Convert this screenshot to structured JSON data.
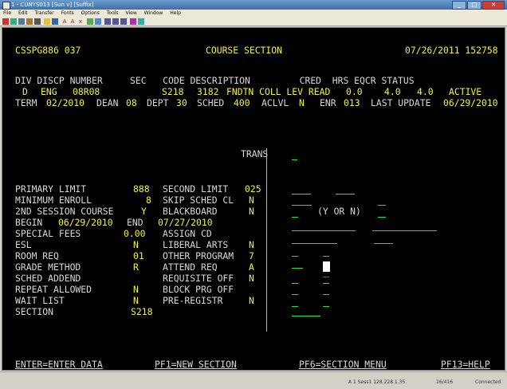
{
  "window": {
    "title": "1 - CUNYS013 [Sun v] [Suffix]",
    "minimize": "_",
    "maximize": "□",
    "close": "✕"
  },
  "menu": [
    "File",
    "Edit",
    "Transfer",
    "Fonts",
    "Options",
    "Tools",
    "View",
    "Window",
    "Help"
  ],
  "screen": {
    "header": {
      "program": "CSSPG886 037",
      "title": "COURSE SECTION",
      "datetime": "07/26/2011 152758"
    },
    "col_headers": "DIV DISCP NUMBER     SEC   CODE DESCRIPTION         CRED  HRS EQCR STATUS",
    "course": {
      "div": "D",
      "discp": "ENG",
      "number": "08R08",
      "sec": "S218",
      "code": "3182",
      "description": "FNDTN COLL LEV READ",
      "cred": "0.0",
      "hrs": "4.0",
      "eqcr": "4.0",
      "status": "ACTIVE"
    },
    "term": {
      "term_label": "TERM",
      "term": "02/2010",
      "dean_label": "DEAN",
      "dean": "08",
      "dept_label": "DEPT",
      "dept": "30",
      "sched_label": "SCHED",
      "sched": "400",
      "aclvl_label": "ACLVL",
      "aclvl": "N",
      "enr_label": "ENR",
      "enr": "013",
      "lastupd_label": "LAST UPDATE",
      "lastupd": "06/29/2010"
    },
    "trans_label": "TRANS",
    "fields": {
      "primary_limit": {
        "label": "PRIMARY LIMIT",
        "value": "888"
      },
      "second_limit": {
        "label": "SECOND LIMIT",
        "value": "025"
      },
      "minimum_enroll": {
        "label": "MINIMUM ENROLL",
        "value": "8"
      },
      "skip_sched_cl": {
        "label": "SKIP SCHED CL",
        "value": "N"
      },
      "second_session": {
        "label": "2ND SESSION COURSE",
        "value": "Y"
      },
      "blackboard": {
        "label": "BLACKBOARD",
        "value": "N"
      },
      "begin": {
        "label": "BEGIN",
        "value": "06/29/2010"
      },
      "end": {
        "label": "END",
        "value": "07/27/2010"
      },
      "special_fees": {
        "label": "SPECIAL FEES",
        "value": "0.00"
      },
      "assign_cd": {
        "label": "ASSIGN CD",
        "value": ""
      },
      "esl": {
        "label": "ESL",
        "value": "N"
      },
      "liberal_arts": {
        "label": "LIBERAL ARTS",
        "value": "N"
      },
      "room_req": {
        "label": "ROOM REQ",
        "value": "01"
      },
      "other_program": {
        "label": "OTHER PROGRAM",
        "value": "7"
      },
      "grade_method": {
        "label": "GRADE METHOD",
        "value": "R"
      },
      "attend_req": {
        "label": "ATTEND REQ",
        "value": "A"
      },
      "sched_addend": {
        "label": "SCHED ADDEND",
        "value": ""
      },
      "requisite_off": {
        "label": "REQUISITE OFF",
        "value": "N"
      },
      "repeat_allowed": {
        "label": "REPEAT ALLOWED",
        "value": "N"
      },
      "block_prg_off": {
        "label": "BLOCK PRG OFF",
        "value": ""
      },
      "wait_list": {
        "label": "WAIT LIST",
        "value": "N"
      },
      "pre_registr": {
        "label": "PRE-REGISTR",
        "value": "N"
      },
      "section": {
        "label": "SECTION",
        "value": "S218"
      }
    },
    "yorn_hint": "(Y OR N)",
    "footer": {
      "enter": "ENTER=ENTER DATA",
      "pf1": "PF1=NEW SECTION",
      "pf6": "PF6=SECTION MENU",
      "pf13": "PF13=HELP"
    }
  },
  "statusbar": {
    "session": "A 1 Sess1 128.228.1.35",
    "pos": "16/416",
    "mode": "Connected"
  },
  "colors": {
    "label": "#d8d8d8",
    "value": "#f2f040",
    "input": "#29e04a",
    "background": "#000000"
  }
}
